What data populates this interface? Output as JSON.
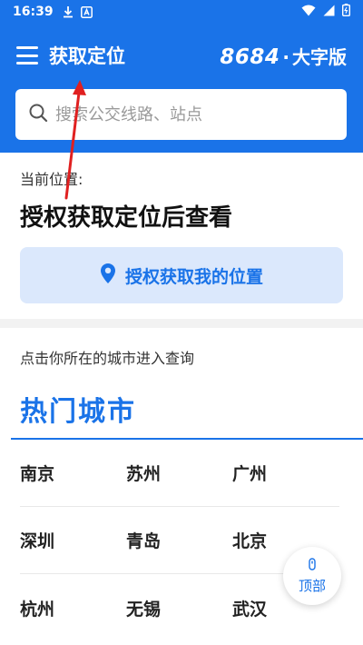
{
  "status_bar": {
    "time": "16:39",
    "icons": [
      "download-icon",
      "app-notification-icon",
      "wifi-icon",
      "signal-icon",
      "battery-icon"
    ]
  },
  "app_bar": {
    "title": "获取定位",
    "brand_number": "8684",
    "brand_dot": "·",
    "brand_edition": "大字版"
  },
  "search": {
    "placeholder": "搜索公交线路、站点"
  },
  "location": {
    "label": "当前位置:",
    "value": "授权获取定位后查看",
    "button_label": "授权获取我的位置"
  },
  "cities": {
    "hint": "点击你所在的城市进入查询",
    "section_title": "热门城市",
    "rows": [
      [
        "南京",
        "苏州",
        "广州"
      ],
      [
        "深圳",
        "青岛",
        "北京"
      ],
      [
        "杭州",
        "无锡",
        "武汉"
      ]
    ]
  },
  "top_button": {
    "label": "顶部"
  },
  "colors": {
    "primary": "#1a73e8",
    "button_bg": "#dbe8fc",
    "annotation_arrow": "#e02020"
  }
}
